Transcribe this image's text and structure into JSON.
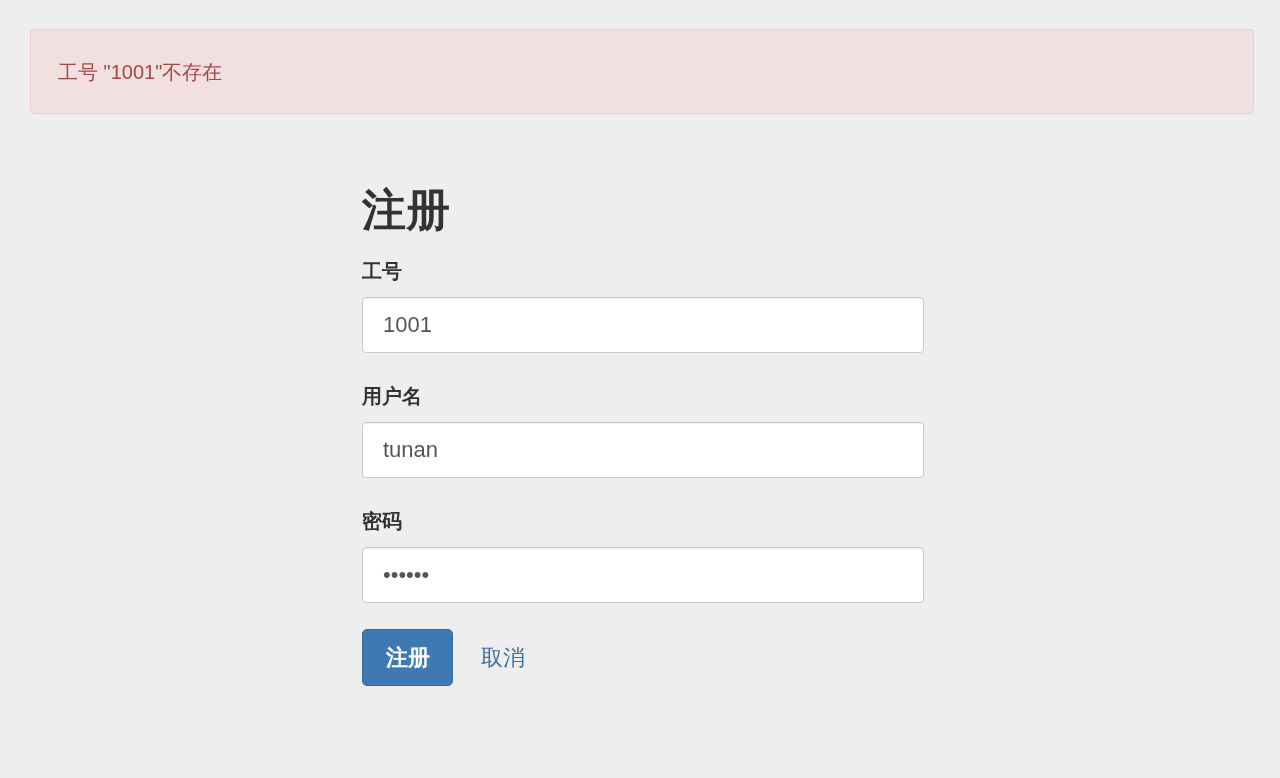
{
  "alert": {
    "message": "工号 \"1001\"不存在"
  },
  "form": {
    "title": "注册",
    "fields": [
      {
        "label": "工号",
        "value": "1001"
      },
      {
        "label": "用户名",
        "value": "tunan"
      },
      {
        "label": "密码",
        "value": "••••••"
      }
    ],
    "actions": [
      {
        "kind": "primary",
        "label": "注册"
      },
      {
        "kind": "link",
        "label": "取消"
      }
    ]
  }
}
